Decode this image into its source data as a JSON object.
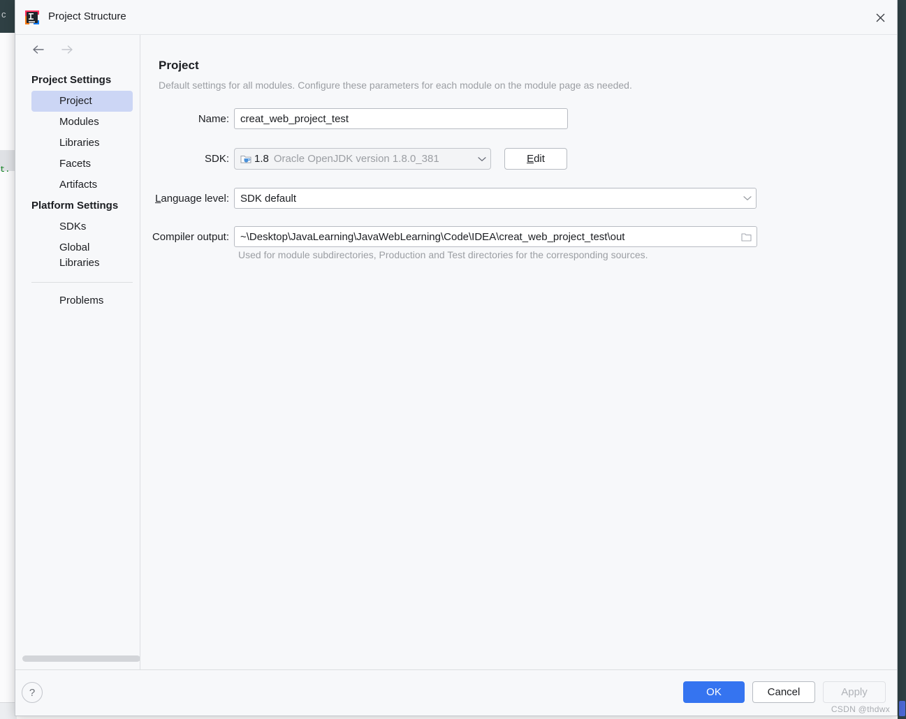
{
  "backdrop": {
    "editor_fragment_1": "t.",
    "editor_fragment_2": "c",
    "editor_fragment_3": ""
  },
  "titlebar": {
    "title": "Project Structure",
    "app_icon": "intellij-idea-icon",
    "close_icon": "close-icon"
  },
  "sidebar": {
    "back_icon": "arrow-left-icon",
    "forward_icon": "arrow-right-icon",
    "groups": [
      {
        "title": "Project Settings",
        "items": [
          {
            "label": "Project",
            "selected": true
          },
          {
            "label": "Modules",
            "selected": false
          },
          {
            "label": "Libraries",
            "selected": false
          },
          {
            "label": "Facets",
            "selected": false
          },
          {
            "label": "Artifacts",
            "selected": false
          }
        ]
      },
      {
        "title": "Platform Settings",
        "items": [
          {
            "label": "SDKs",
            "selected": false
          },
          {
            "label": "Global Libraries",
            "selected": false
          }
        ]
      }
    ],
    "extra_items": [
      {
        "label": "Problems",
        "selected": false
      }
    ]
  },
  "main": {
    "page_title": "Project",
    "page_description": "Default settings for all modules. Configure these parameters for each module on the module page as needed.",
    "fields": {
      "name": {
        "label": "Name:",
        "value": "creat_web_project_test"
      },
      "sdk": {
        "label": "SDK:",
        "icon": "java-sdk-folder-icon",
        "value": "1.8",
        "detail": "Oracle OpenJDK version 1.8.0_381",
        "chevron_icon": "chevron-down-icon",
        "edit_button": "Edit",
        "edit_button_mnemonic": "E",
        "edit_button_rest": "dit"
      },
      "language_level": {
        "label": "Language level:",
        "label_mnemonic": "L",
        "label_rest": "anguage level:",
        "value": "SDK default",
        "chevron_icon": "chevron-down-icon"
      },
      "compiler_output": {
        "label": "Compiler output:",
        "value": "~\\Desktop\\JavaLearning\\JavaWebLearning\\Code\\IDEA\\creat_web_project_test\\out",
        "browse_icon": "folder-icon",
        "hint": "Used for module subdirectories, Production and Test directories for the corresponding sources."
      }
    }
  },
  "footer": {
    "help_label": "?",
    "help_icon": "help-icon",
    "ok_label": "OK",
    "cancel_label": "Cancel",
    "apply_label": "Apply",
    "apply_enabled": false
  },
  "watermark": "CSDN @thdwx",
  "colors": {
    "accent": "#3574f0",
    "selection": "#ccd6f5",
    "dialog_bg": "#f7f8fa",
    "muted_text": "#9b9ea3",
    "ide_dark": "#2f4044"
  }
}
